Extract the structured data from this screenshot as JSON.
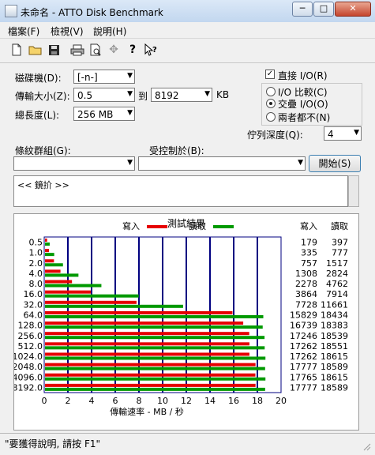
{
  "window": {
    "title": "未命名 - ATTO Disk Benchmark",
    "minimize_icon": "minimize-icon",
    "maximize_icon": "maximize-icon",
    "close_icon": "close-icon"
  },
  "menu": [
    "檔案(F)",
    "檢視(V)",
    "說明(H)"
  ],
  "toolbar_icons": [
    "new-document-icon",
    "open-folder-icon",
    "save-disk-icon",
    "print-icon",
    "print-preview-icon",
    "move-icon",
    "help-icon",
    "context-help-icon"
  ],
  "form": {
    "drive_label": "磁碟機(D):",
    "drive_value": "[-n-]",
    "transfer_label": "傳輸大小(Z):",
    "transfer_from": "0.5",
    "to_label": "到",
    "transfer_to": "8192",
    "kb_label": "KB",
    "total_label": "總長度(L):",
    "total_value": "256 MB",
    "direct_io_label": "直接 I/O(R)",
    "direct_io_checked": true,
    "io_compare_label": "I/O 比較(C)",
    "overlapped_io_label": "交疊 I/O(O)",
    "neither_label": "兩者都不(N)",
    "queue_label": "佇列深度(Q):",
    "queue_value": "4",
    "test_pattern_label": "條紋群組(G):",
    "test_pattern_value": "",
    "controlled_by_label": "受控制於(B):",
    "controlled_by_value": "",
    "start_button": "開始(S)",
    "description": "<< 鏡扴 >>"
  },
  "results": {
    "title": "測試結果",
    "write_legend": "寫入",
    "read_legend": "讀取",
    "write_col": "寫入",
    "read_col": "讀取",
    "write_color": "#e60000",
    "read_color": "#009900",
    "grid_color": "#000080"
  },
  "chart_data": {
    "type": "bar",
    "orientation": "horizontal",
    "categories": [
      "0.5",
      "1.0",
      "2.0",
      "4.0",
      "8.0",
      "16.0",
      "32.0",
      "64.0",
      "128.0",
      "256.0",
      "512.0",
      "1024.0",
      "2048.0",
      "4096.0",
      "8192.0"
    ],
    "series": [
      {
        "name": "寫入",
        "values": [
          179,
          335,
          757,
          1308,
          2278,
          3864,
          7728,
          15829,
          16739,
          17246,
          17262,
          17262,
          17777,
          17765,
          17777
        ]
      },
      {
        "name": "讀取",
        "values": [
          397,
          777,
          1517,
          2824,
          4762,
          7914,
          11661,
          18434,
          18383,
          18539,
          18551,
          18615,
          18589,
          18615,
          18589
        ]
      }
    ],
    "x_ticks": [
      "0",
      "2",
      "4",
      "6",
      "8",
      "10",
      "12",
      "14",
      "16",
      "18",
      "20"
    ],
    "xlabel": "傳輸速率 - MB / 秒",
    "xlim": [
      0,
      20
    ],
    "grid": true,
    "legend": "top-center"
  },
  "status": "\"要獲得說明, 請按 F1\""
}
